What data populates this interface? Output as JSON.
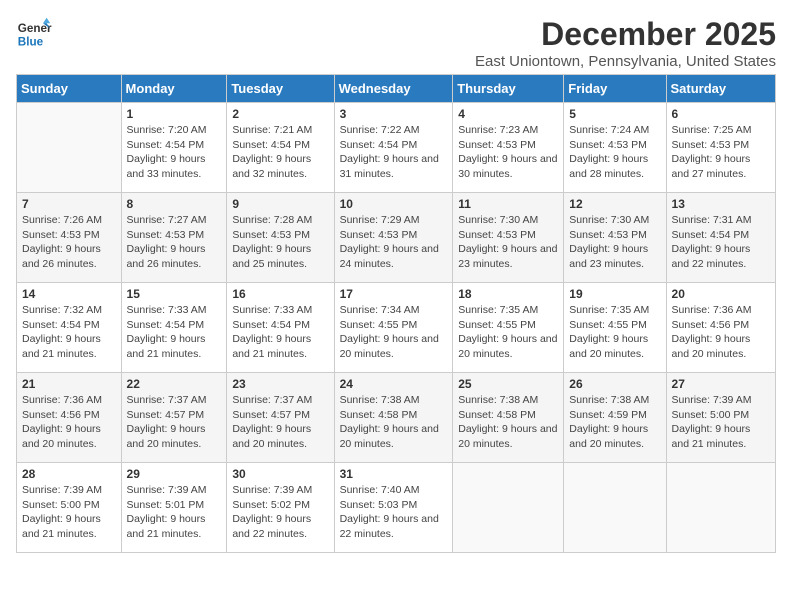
{
  "logo": {
    "line1": "General",
    "line2": "Blue"
  },
  "title": "December 2025",
  "subtitle": "East Uniontown, Pennsylvania, United States",
  "days_of_week": [
    "Sunday",
    "Monday",
    "Tuesday",
    "Wednesday",
    "Thursday",
    "Friday",
    "Saturday"
  ],
  "weeks": [
    [
      {
        "num": "",
        "sunrise": "",
        "sunset": "",
        "daylight": ""
      },
      {
        "num": "1",
        "sunrise": "Sunrise: 7:20 AM",
        "sunset": "Sunset: 4:54 PM",
        "daylight": "Daylight: 9 hours and 33 minutes."
      },
      {
        "num": "2",
        "sunrise": "Sunrise: 7:21 AM",
        "sunset": "Sunset: 4:54 PM",
        "daylight": "Daylight: 9 hours and 32 minutes."
      },
      {
        "num": "3",
        "sunrise": "Sunrise: 7:22 AM",
        "sunset": "Sunset: 4:54 PM",
        "daylight": "Daylight: 9 hours and 31 minutes."
      },
      {
        "num": "4",
        "sunrise": "Sunrise: 7:23 AM",
        "sunset": "Sunset: 4:53 PM",
        "daylight": "Daylight: 9 hours and 30 minutes."
      },
      {
        "num": "5",
        "sunrise": "Sunrise: 7:24 AM",
        "sunset": "Sunset: 4:53 PM",
        "daylight": "Daylight: 9 hours and 28 minutes."
      },
      {
        "num": "6",
        "sunrise": "Sunrise: 7:25 AM",
        "sunset": "Sunset: 4:53 PM",
        "daylight": "Daylight: 9 hours and 27 minutes."
      }
    ],
    [
      {
        "num": "7",
        "sunrise": "Sunrise: 7:26 AM",
        "sunset": "Sunset: 4:53 PM",
        "daylight": "Daylight: 9 hours and 26 minutes."
      },
      {
        "num": "8",
        "sunrise": "Sunrise: 7:27 AM",
        "sunset": "Sunset: 4:53 PM",
        "daylight": "Daylight: 9 hours and 26 minutes."
      },
      {
        "num": "9",
        "sunrise": "Sunrise: 7:28 AM",
        "sunset": "Sunset: 4:53 PM",
        "daylight": "Daylight: 9 hours and 25 minutes."
      },
      {
        "num": "10",
        "sunrise": "Sunrise: 7:29 AM",
        "sunset": "Sunset: 4:53 PM",
        "daylight": "Daylight: 9 hours and 24 minutes."
      },
      {
        "num": "11",
        "sunrise": "Sunrise: 7:30 AM",
        "sunset": "Sunset: 4:53 PM",
        "daylight": "Daylight: 9 hours and 23 minutes."
      },
      {
        "num": "12",
        "sunrise": "Sunrise: 7:30 AM",
        "sunset": "Sunset: 4:53 PM",
        "daylight": "Daylight: 9 hours and 23 minutes."
      },
      {
        "num": "13",
        "sunrise": "Sunrise: 7:31 AM",
        "sunset": "Sunset: 4:54 PM",
        "daylight": "Daylight: 9 hours and 22 minutes."
      }
    ],
    [
      {
        "num": "14",
        "sunrise": "Sunrise: 7:32 AM",
        "sunset": "Sunset: 4:54 PM",
        "daylight": "Daylight: 9 hours and 21 minutes."
      },
      {
        "num": "15",
        "sunrise": "Sunrise: 7:33 AM",
        "sunset": "Sunset: 4:54 PM",
        "daylight": "Daylight: 9 hours and 21 minutes."
      },
      {
        "num": "16",
        "sunrise": "Sunrise: 7:33 AM",
        "sunset": "Sunset: 4:54 PM",
        "daylight": "Daylight: 9 hours and 21 minutes."
      },
      {
        "num": "17",
        "sunrise": "Sunrise: 7:34 AM",
        "sunset": "Sunset: 4:55 PM",
        "daylight": "Daylight: 9 hours and 20 minutes."
      },
      {
        "num": "18",
        "sunrise": "Sunrise: 7:35 AM",
        "sunset": "Sunset: 4:55 PM",
        "daylight": "Daylight: 9 hours and 20 minutes."
      },
      {
        "num": "19",
        "sunrise": "Sunrise: 7:35 AM",
        "sunset": "Sunset: 4:55 PM",
        "daylight": "Daylight: 9 hours and 20 minutes."
      },
      {
        "num": "20",
        "sunrise": "Sunrise: 7:36 AM",
        "sunset": "Sunset: 4:56 PM",
        "daylight": "Daylight: 9 hours and 20 minutes."
      }
    ],
    [
      {
        "num": "21",
        "sunrise": "Sunrise: 7:36 AM",
        "sunset": "Sunset: 4:56 PM",
        "daylight": "Daylight: 9 hours and 20 minutes."
      },
      {
        "num": "22",
        "sunrise": "Sunrise: 7:37 AM",
        "sunset": "Sunset: 4:57 PM",
        "daylight": "Daylight: 9 hours and 20 minutes."
      },
      {
        "num": "23",
        "sunrise": "Sunrise: 7:37 AM",
        "sunset": "Sunset: 4:57 PM",
        "daylight": "Daylight: 9 hours and 20 minutes."
      },
      {
        "num": "24",
        "sunrise": "Sunrise: 7:38 AM",
        "sunset": "Sunset: 4:58 PM",
        "daylight": "Daylight: 9 hours and 20 minutes."
      },
      {
        "num": "25",
        "sunrise": "Sunrise: 7:38 AM",
        "sunset": "Sunset: 4:58 PM",
        "daylight": "Daylight: 9 hours and 20 minutes."
      },
      {
        "num": "26",
        "sunrise": "Sunrise: 7:38 AM",
        "sunset": "Sunset: 4:59 PM",
        "daylight": "Daylight: 9 hours and 20 minutes."
      },
      {
        "num": "27",
        "sunrise": "Sunrise: 7:39 AM",
        "sunset": "Sunset: 5:00 PM",
        "daylight": "Daylight: 9 hours and 21 minutes."
      }
    ],
    [
      {
        "num": "28",
        "sunrise": "Sunrise: 7:39 AM",
        "sunset": "Sunset: 5:00 PM",
        "daylight": "Daylight: 9 hours and 21 minutes."
      },
      {
        "num": "29",
        "sunrise": "Sunrise: 7:39 AM",
        "sunset": "Sunset: 5:01 PM",
        "daylight": "Daylight: 9 hours and 21 minutes."
      },
      {
        "num": "30",
        "sunrise": "Sunrise: 7:39 AM",
        "sunset": "Sunset: 5:02 PM",
        "daylight": "Daylight: 9 hours and 22 minutes."
      },
      {
        "num": "31",
        "sunrise": "Sunrise: 7:40 AM",
        "sunset": "Sunset: 5:03 PM",
        "daylight": "Daylight: 9 hours and 22 minutes."
      },
      {
        "num": "",
        "sunrise": "",
        "sunset": "",
        "daylight": ""
      },
      {
        "num": "",
        "sunrise": "",
        "sunset": "",
        "daylight": ""
      },
      {
        "num": "",
        "sunrise": "",
        "sunset": "",
        "daylight": ""
      }
    ]
  ]
}
